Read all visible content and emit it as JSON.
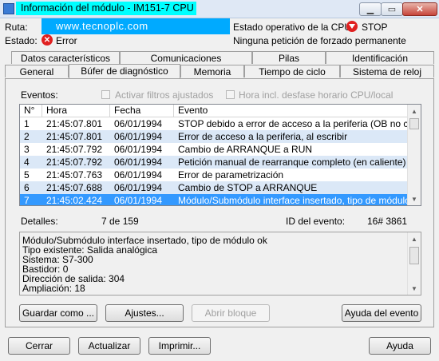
{
  "window": {
    "title": "Información del módulo - IM151-7 CPU",
    "controls": [
      "minimize",
      "restore",
      "close"
    ]
  },
  "header": {
    "ruta_label": "Ruta:",
    "banner": "www.tecnoplc.com",
    "estado_label": "Estado:",
    "estado_value": "Error",
    "cpu_state_label": "Estado operativo de la CPU:",
    "cpu_state_value": "STOP",
    "forcing_text": "Ninguna petición de forzado permanente"
  },
  "tabs": {
    "row1": [
      "Datos característicos",
      "Comunicaciones",
      "Pilas",
      "Identificación"
    ],
    "row2": [
      "General",
      "Búfer de diagnóstico",
      "Memoria",
      "Tiempo de ciclo",
      "Sistema de reloj"
    ],
    "active": "Búfer de diagnóstico"
  },
  "events_section": {
    "label": "Eventos:",
    "filter_checkbox": "Activar filtros ajustados",
    "time_checkbox": "Hora incl. desfase horario CPU/local"
  },
  "table": {
    "columns": [
      "N°",
      "Hora",
      "Fecha",
      "Evento"
    ],
    "rows": [
      {
        "n": "1",
        "hora": "21:45:07.801",
        "fecha": "06/01/1994",
        "evento": "STOP debido a error de acceso a la periferia (OB no carga..."
      },
      {
        "n": "2",
        "hora": "21:45:07.801",
        "fecha": "06/01/1994",
        "evento": "Error de acceso a la periferia, al escribir"
      },
      {
        "n": "3",
        "hora": "21:45:07.792",
        "fecha": "06/01/1994",
        "evento": "Cambio de ARRANQUE a RUN"
      },
      {
        "n": "4",
        "hora": "21:45:07.792",
        "fecha": "06/01/1994",
        "evento": "Petición manual de rearranque completo (en caliente)"
      },
      {
        "n": "5",
        "hora": "21:45:07.763",
        "fecha": "06/01/1994",
        "evento": "Error de parametrización"
      },
      {
        "n": "6",
        "hora": "21:45:07.688",
        "fecha": "06/01/1994",
        "evento": "Cambio de STOP a ARRANQUE"
      },
      {
        "n": "7",
        "hora": "21:45:02.424",
        "fecha": "06/01/1994",
        "evento": "Módulo/Submódulo interface insertado, tipo de módulo ok"
      }
    ],
    "selected_row": "7"
  },
  "details": {
    "label": "Detalles:",
    "position": "7 de 159",
    "event_id_label": "ID del evento:",
    "event_id_value": "16# 3861",
    "lines": [
      "Módulo/Submódulo interface insertado, tipo de módulo ok",
      "Tipo existente:  Salida analógica",
      "Sistema: S7-300",
      "Bastidor:    0",
      "Dirección de salida:    304",
      "Ampliación: 18"
    ]
  },
  "panel_buttons": {
    "save": "Guardar como ...",
    "settings": "Ajustes...",
    "open_block": "Abrir bloque",
    "event_help": "Ayuda del evento"
  },
  "footer_buttons": {
    "close": "Cerrar",
    "refresh": "Actualizar",
    "print": "Imprimir...",
    "help": "Ayuda"
  },
  "colors": {
    "title_highlight": "#00ffff",
    "banner": "#00aaff",
    "row_alt": "#dbe8f7",
    "row_selected": "#3399ff",
    "error_red": "#e02020"
  }
}
